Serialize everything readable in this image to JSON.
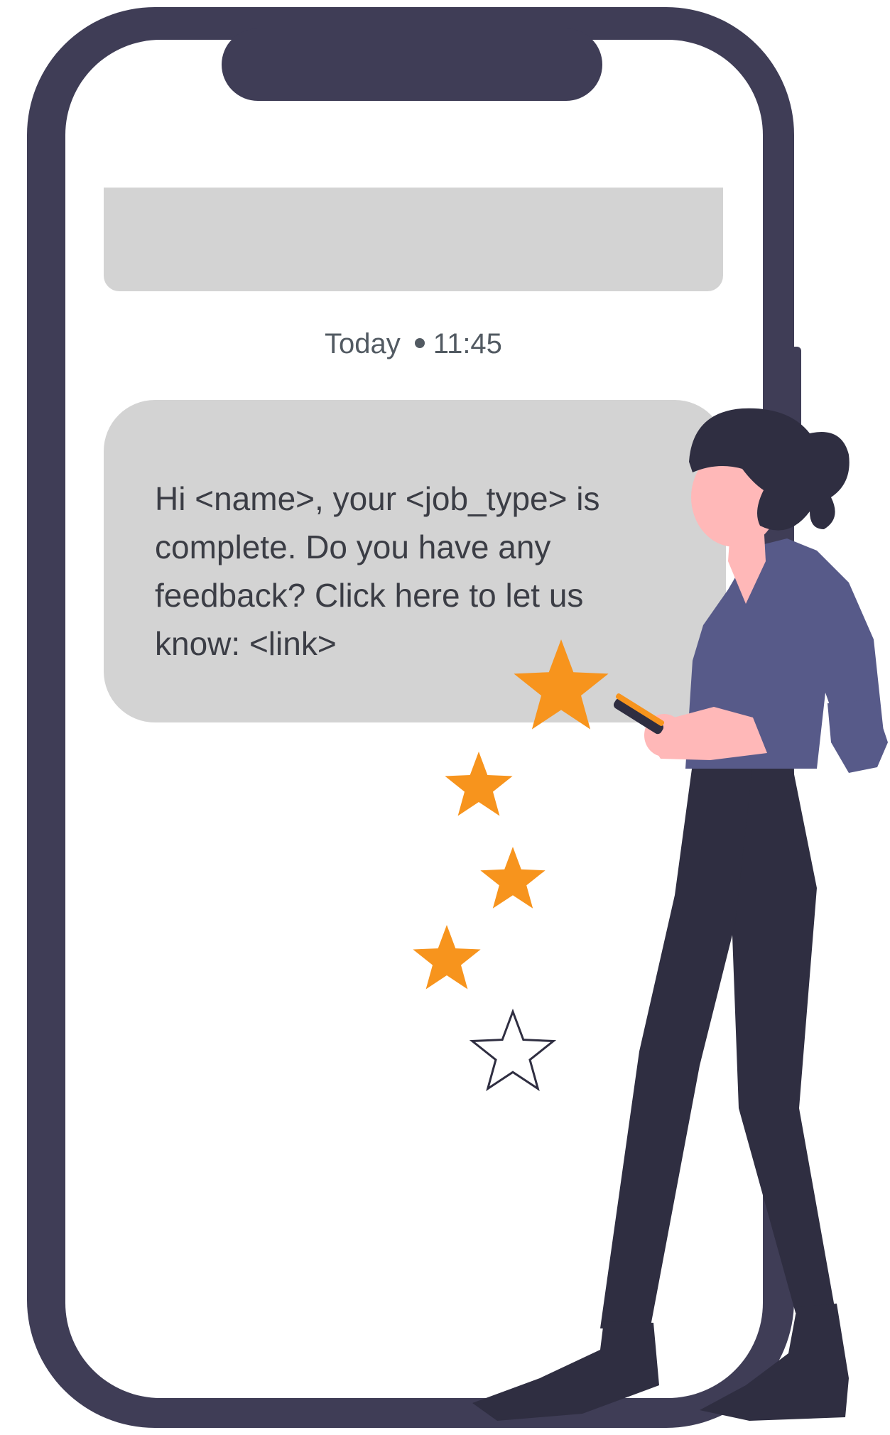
{
  "message": {
    "date_label": "Today",
    "time_label": "11:45",
    "body": "Hi <name>, your <job_type> is complete. Do you have any feedback? Click here to let us know: <link>"
  },
  "rating": {
    "filled_stars": 4,
    "total_stars": 5
  },
  "colors": {
    "phone_frame": "#3f3d56",
    "screen_bubble": "#d3d3d3",
    "star_fill": "#f7941d",
    "shirt": "#575a89",
    "pants": "#2f2e41",
    "skin": "#ffb8b8"
  },
  "icons": [
    "star-icon",
    "star-outline-icon",
    "smartphone-icon"
  ]
}
